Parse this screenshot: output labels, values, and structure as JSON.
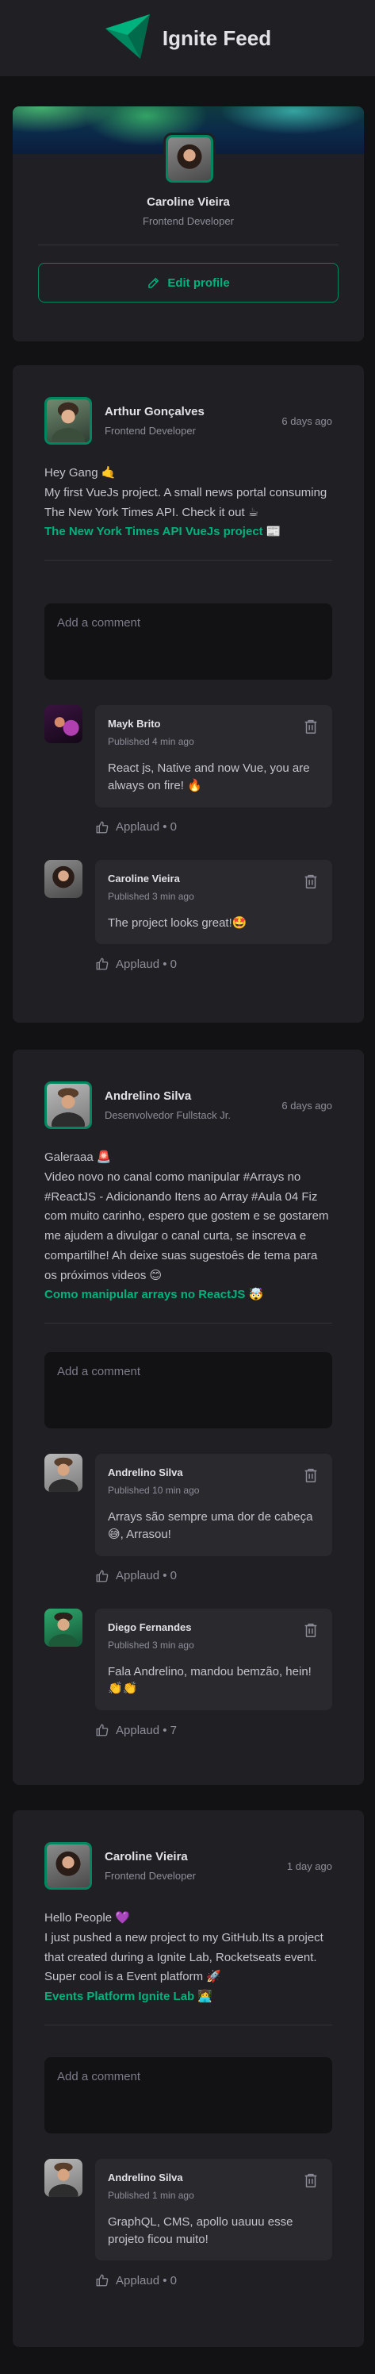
{
  "app": {
    "title": "Ignite Feed"
  },
  "profile": {
    "name": "Caroline Vieira",
    "role": "Frontend Developer",
    "edit_label": "Edit profile"
  },
  "comment_placeholder": "Add a comment",
  "posts": [
    {
      "author": "Arthur Gonçalves",
      "role": "Frontend Developer",
      "time": "6 days ago",
      "lines": [
        "Hey Gang 🤙",
        "My first VueJs project. A small news portal consuming The New York Times API. Check it out ☕"
      ],
      "link": "The New York Times API VueJs project 📰",
      "comments": [
        {
          "name": "Mayk Brito",
          "time": "Published 4 min ago",
          "text": "React js, Native and now Vue, you are always on fire! 🔥",
          "applaud": "Applaud • 0"
        },
        {
          "name": "Caroline Vieira",
          "time": "Published 3 min ago",
          "text": "The project looks great!🤩",
          "applaud": "Applaud • 0"
        }
      ]
    },
    {
      "author": "Andrelino Silva",
      "role": "Desenvolvedor Fullstack Jr.",
      "time": "6 days ago",
      "lines": [
        "Galeraaa 🚨",
        "Video novo no canal como manipular #Arrays no #ReactJS - Adicionando Itens ao Array #Aula 04 Fiz com muito carinho, espero que gostem e se gostarem me ajudem a divulgar o canal curta, se inscreva e compartilhe! Ah deixe suas sugestoês de tema para os próximos videos 😊"
      ],
      "link": "Como manipular arrays no ReactJS 🤯",
      "comments": [
        {
          "name": "Andrelino Silva",
          "time": "Published 10 min ago",
          "text": "Arrays são sempre uma dor de cabeça 😅, Arrasou!",
          "applaud": "Applaud • 0"
        },
        {
          "name": "Diego Fernandes",
          "time": "Published 3 min ago",
          "text": "Fala Andrelino, mandou bemzão, hein! 👏👏",
          "applaud": "Applaud • 7"
        }
      ]
    },
    {
      "author": "Caroline Vieira",
      "role": "Frontend Developer",
      "time": "1 day ago",
      "lines": [
        "Hello People 💜",
        "I just pushed a new project to my GitHub.Its a project that created during a Ignite Lab, Rocketseats event. Super cool is a Event platform 🚀"
      ],
      "link": "Events Platform Ignite Lab 👩‍💻",
      "comments": [
        {
          "name": "Andrelino Silva",
          "time": "Published 1 min ago",
          "text": "GraphQL, CMS, apollo uauuu esse projeto ficou muito!",
          "applaud": "Applaud • 0"
        }
      ]
    }
  ],
  "colors": {
    "accent": "#00b37e",
    "border": "#00875f",
    "card": "#202024",
    "bg": "#121214"
  }
}
